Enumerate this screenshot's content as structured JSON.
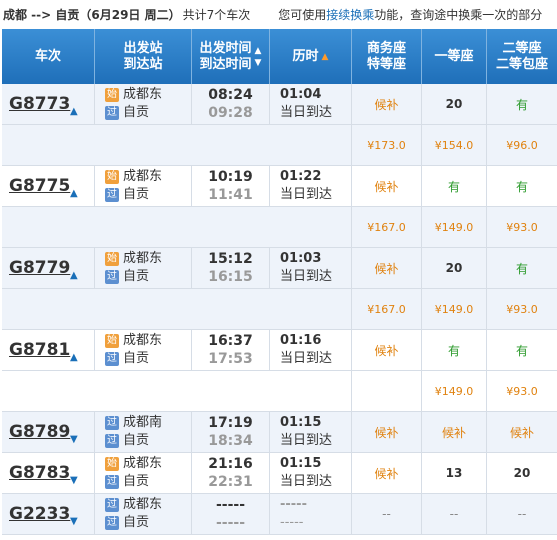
{
  "header": {
    "route": "成都 --> 自贡（6月29日  周二）",
    "count": "共计7个车次",
    "hint_pre": "您可使用",
    "hint_link": "接续换乘",
    "hint_post": "功能，查询途中换乘一次的部分"
  },
  "columns": {
    "train": "车次",
    "station_top": "出发站",
    "station_bottom": "到达站",
    "time_top": "出发时间",
    "time_bottom": "到达时间",
    "duration": "历时",
    "business_top": "商务座",
    "business_bottom": "特等座",
    "first": "一等座",
    "second_top": "二等座",
    "second_bottom": "二等包座"
  },
  "trains": [
    {
      "no": "G8773",
      "from": "成都东",
      "from_badge": "始",
      "to": "自贡",
      "to_badge": "过",
      "dep": "08:24",
      "arr": "09:28",
      "dur": "01:04",
      "day": "当日到达",
      "business": "候补",
      "first": "20",
      "second": "有",
      "p_business": "¥173.0",
      "p_first": "¥154.0",
      "p_second": "¥96.0"
    },
    {
      "no": "G8775",
      "from": "成都东",
      "from_badge": "始",
      "to": "自贡",
      "to_badge": "过",
      "dep": "10:19",
      "arr": "11:41",
      "dur": "01:22",
      "day": "当日到达",
      "business": "候补",
      "first": "有",
      "second": "有",
      "p_business": "¥167.0",
      "p_first": "¥149.0",
      "p_second": "¥93.0"
    },
    {
      "no": "G8779",
      "from": "成都东",
      "from_badge": "始",
      "to": "自贡",
      "to_badge": "过",
      "dep": "15:12",
      "arr": "16:15",
      "dur": "01:03",
      "day": "当日到达",
      "business": "候补",
      "first": "20",
      "second": "有",
      "p_business": "¥167.0",
      "p_first": "¥149.0",
      "p_second": "¥93.0"
    },
    {
      "no": "G8781",
      "from": "成都东",
      "from_badge": "始",
      "to": "自贡",
      "to_badge": "过",
      "dep": "16:37",
      "arr": "17:53",
      "dur": "01:16",
      "day": "当日到达",
      "business": "候补",
      "first": "有",
      "second": "有",
      "p_business": "",
      "p_first": "¥149.0",
      "p_second": "¥93.0"
    },
    {
      "no": "G8789",
      "from": "成都南",
      "from_badge": "过",
      "to": "自贡",
      "to_badge": "过",
      "dep": "17:19",
      "arr": "18:34",
      "dur": "01:15",
      "day": "当日到达",
      "business": "候补",
      "first": "候补",
      "second": "候补"
    },
    {
      "no": "G8783",
      "from": "成都东",
      "from_badge": "始",
      "to": "自贡",
      "to_badge": "过",
      "dep": "21:16",
      "arr": "22:31",
      "dur": "01:15",
      "day": "当日到达",
      "business": "候补",
      "first": "13",
      "second": "20"
    },
    {
      "no": "G2233",
      "from": "成都东",
      "from_badge": "过",
      "to": "自贡",
      "to_badge": "过",
      "dep": "-----",
      "arr": "-----",
      "dur": "-----",
      "day": "-----",
      "business": "--",
      "first": "--",
      "second": "--"
    }
  ],
  "colors": {
    "header_blue": "#1f6fb9",
    "orange": "#e0820f",
    "green": "#2b9a2b"
  }
}
